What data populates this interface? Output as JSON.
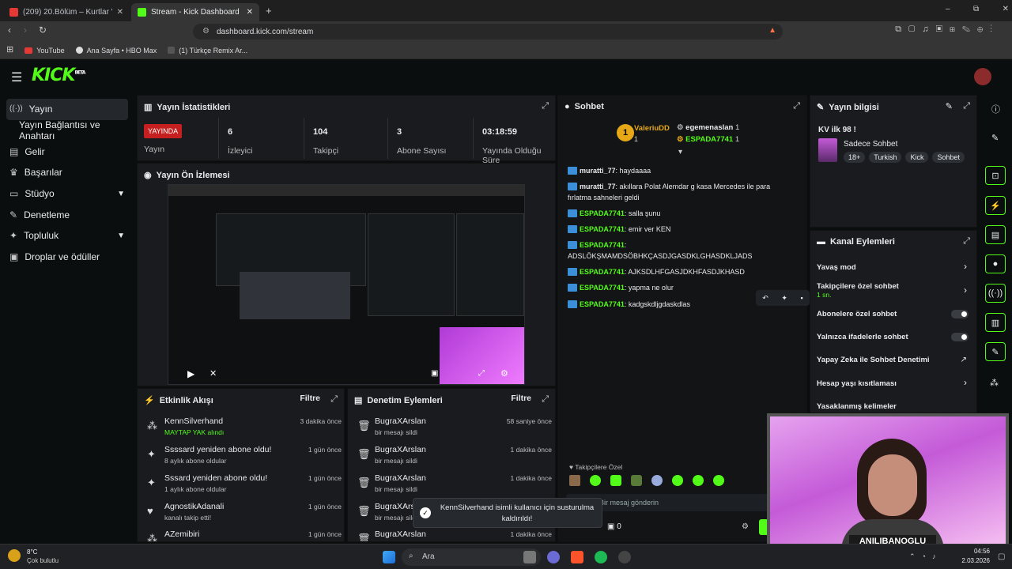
{
  "browser": {
    "tabs": [
      {
        "label": "(209) 20.Bölüm – Kurtlar Vadisi | 4K - "
      },
      {
        "label": "Stream - Kick Dashboard"
      }
    ],
    "new_tab": "+",
    "url": "dashboard.kick.com/stream",
    "bookmarks": [
      "YouTube",
      "Ana Sayfa • HBO Max",
      "(1) Türkçe Remix Ar..."
    ],
    "window_controls": [
      "–",
      "⧉",
      "✕"
    ]
  },
  "kick": {
    "logo": "KICK",
    "logo_badge": "BETA",
    "sidebar": {
      "items": [
        {
          "label": "Yayın",
          "icon": "broadcast-icon"
        },
        {
          "label": "Yayın Bağlantısı ve Anahtarı",
          "icon": ""
        },
        {
          "label": "Gelir",
          "icon": "chart-icon"
        },
        {
          "label": "Başarılar",
          "icon": "trophy-icon"
        },
        {
          "label": "Stüdyo",
          "icon": "studio-icon"
        },
        {
          "label": "Denetleme",
          "icon": "wrench-icon"
        },
        {
          "label": "Topluluk",
          "icon": "users-icon"
        },
        {
          "label": "Droplar ve ödüller",
          "icon": "gift-icon"
        }
      ]
    },
    "stats": {
      "title": "Yayın İstatistikleri",
      "live_badge": "YAYINDA",
      "items": [
        {
          "value": "",
          "label": "Yayın"
        },
        {
          "value": "6",
          "label": "İzleyici"
        },
        {
          "value": "104",
          "label": "Takipçi"
        },
        {
          "value": "3",
          "label": "Abone Sayısı"
        },
        {
          "value": "03:18:59",
          "label": "Yayında Olduğu Süre"
        }
      ]
    },
    "preview": {
      "title": "Yayın Ön İzlemesi"
    },
    "events": {
      "title": "Etkinlik Akışı",
      "filter": "Filtre",
      "rows": [
        {
          "icon": "users-icon",
          "name": "KennSilverhand",
          "sub": "MAYTAP YAK alındı",
          "time": "3 dakika önce"
        },
        {
          "icon": "sparkle-icon",
          "name": "Ssssard yeniden abone oldu!",
          "sub": "8 aylık abone oldular",
          "time": "1 gün önce"
        },
        {
          "icon": "sparkle-icon",
          "name": "Sssard yeniden abone oldu!",
          "sub": "1 aylık abone oldular",
          "time": "1 gün önce"
        },
        {
          "icon": "heart-icon",
          "name": "AgnostikAdanali",
          "sub": "kanalı takip etti!",
          "time": "1 gün önce"
        },
        {
          "icon": "users-icon",
          "name": "AZemibiri",
          "sub": "",
          "time": "1 gün önce"
        }
      ]
    },
    "moderation": {
      "title": "Denetim Eylemleri",
      "filter": "Filtre",
      "rows": [
        {
          "name": "BugraXArslan",
          "sub": "bir mesajı sildi",
          "time": "58 saniye önce"
        },
        {
          "name": "BugraXArslan",
          "sub": "bir mesajı sildi",
          "time": "1 dakika önce"
        },
        {
          "name": "BugraXArslan",
          "sub": "bir mesajı sildi",
          "time": "1 dakika önce"
        },
        {
          "name": "BugraXArs",
          "sub": "bir mesajı sildi",
          "time": ""
        },
        {
          "name": "BugraXArslan",
          "sub": "",
          "time": "1 dakika önce"
        }
      ]
    },
    "chat": {
      "title": "Sohbet",
      "leaderboard": [
        {
          "name": "ValeriuDD",
          "count": "1"
        },
        {
          "name": "egemenaslan",
          "count": "1"
        },
        {
          "name": "ESPADA7741",
          "count": "1"
        }
      ],
      "messages": [
        {
          "user": "muratti_77",
          "text": "haydaaaa",
          "badge": true,
          "green": false
        },
        {
          "user": "muratti_77",
          "text": "akıllara Polat Alemdar g kasa Mercedes ile para fırlatma sahneleri geldi",
          "badge": true,
          "green": false
        },
        {
          "user": "ESPADA7741",
          "text": "salla şunu",
          "badge": true,
          "green": true
        },
        {
          "user": "ESPADA7741",
          "text": "emir ver KEN",
          "badge": true,
          "green": true
        },
        {
          "user": "ESPADA7741",
          "text": "ADSLÖKŞMAMDSÖBHKÇASDJGASDKLGHASDKLJADS",
          "badge": true,
          "green": true
        },
        {
          "user": "ESPADA7741",
          "text": "AJKSDLHFGASJDKHFASDJKHASD",
          "badge": true,
          "green": true
        },
        {
          "user": "ESPADA7741",
          "text": "yapma ne olur",
          "badge": true,
          "green": true
        },
        {
          "user": "ESPADA7741",
          "text": "kadgskdljgdaskdlas",
          "badge": true,
          "green": true
        }
      ],
      "followers_only": "Takipçilere Özel",
      "input_placeholder": "Bir mesaj gönderin",
      "points": "0",
      "toast": "KennSilverhand isimli kullanıcı için susturulma kaldırıldı!"
    },
    "stream_info": {
      "title": "Yayın bilgisi",
      "stream_title": "KV ilk 98 !",
      "category": "Sadece Sohbet",
      "tags": [
        "18+",
        "Turkish",
        "Kick",
        "Sohbet"
      ]
    },
    "channel_actions": {
      "title": "Kanal Eylemleri",
      "items": [
        {
          "label": "Yavaş mod",
          "sub": "",
          "control": "chevron"
        },
        {
          "label": "Takipçilere özel sohbet",
          "sub": "1 sn.",
          "control": "chevron"
        },
        {
          "label": "Abonelere özel sohbet",
          "sub": "",
          "control": "toggle"
        },
        {
          "label": "Yalnızca ifadelerle sohbet",
          "sub": "",
          "control": "toggle"
        },
        {
          "label": "Yapay Zeka ile Sohbet Denetimi",
          "sub": "",
          "control": "external"
        },
        {
          "label": "Hesap yaşı kısıtlaması",
          "sub": "",
          "control": "chevron"
        },
        {
          "label": "Yasaklanmış kelimeler",
          "sub": "",
          "control": "chevron"
        }
      ]
    },
    "webcam_name": "ANILIBANOGLU"
  },
  "taskbar": {
    "weather_temp": "8°C",
    "weather_desc": "Çok bulutlu",
    "search": "Ara",
    "time": "04:56",
    "date": "2.03.2026"
  },
  "colors": {
    "accent": "#53fc18",
    "panel": "#191b1f",
    "live": "#c61f1f"
  }
}
